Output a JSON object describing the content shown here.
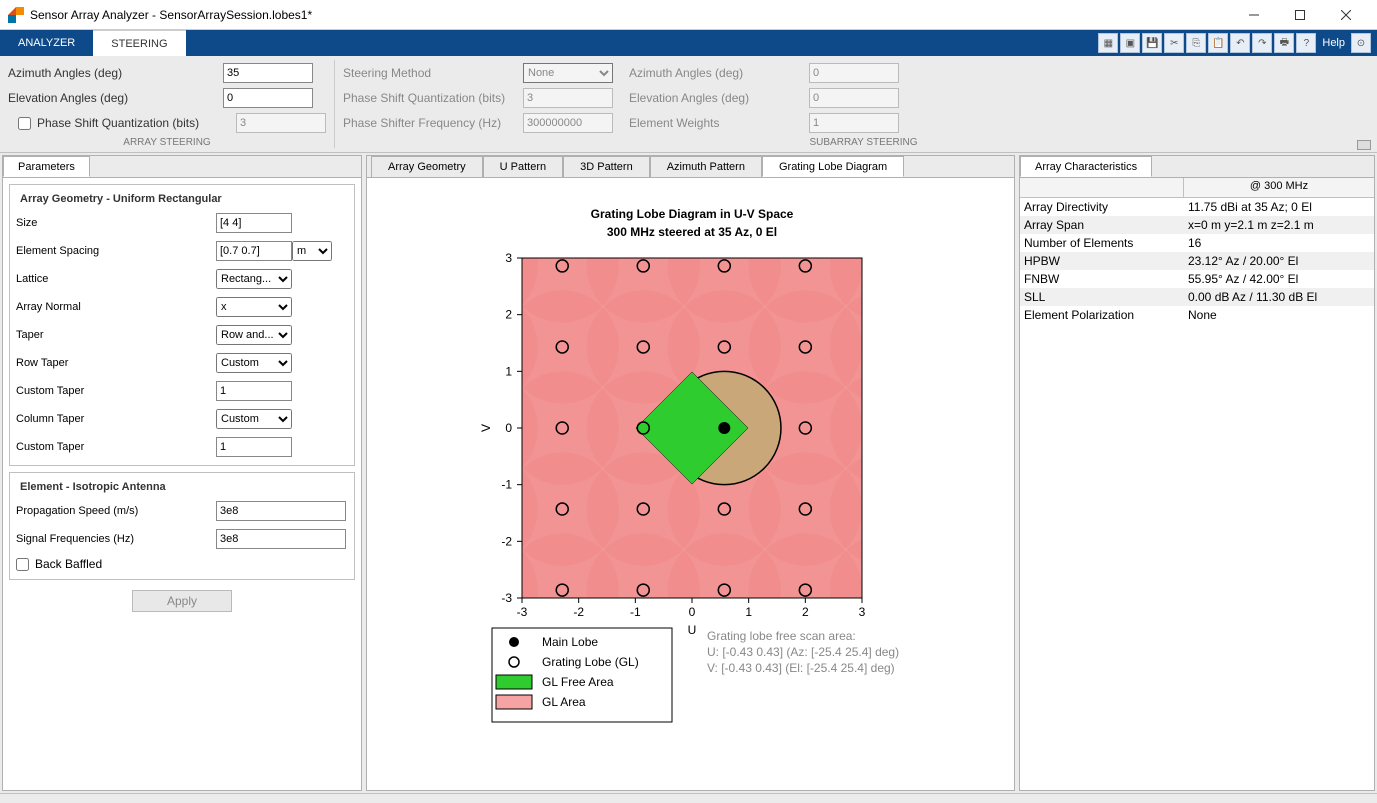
{
  "window": {
    "title": "Sensor Array Analyzer - SensorArraySession.lobes1*"
  },
  "ribbon": {
    "tabs": [
      "ANALYZER",
      "STEERING"
    ],
    "active": 1,
    "help": "Help"
  },
  "toolstrip": {
    "array_steering": {
      "azimuth_label": "Azimuth Angles (deg)",
      "azimuth_value": "35",
      "elevation_label": "Elevation Angles (deg)",
      "elevation_value": "0",
      "psq_label": "Phase Shift Quantization (bits)",
      "psq_value": "3",
      "group": "ARRAY STEERING"
    },
    "subarray_steering": {
      "method_label": "Steering Method",
      "method_value": "None",
      "psq_label": "Phase Shift Quantization (bits)",
      "psq_value": "3",
      "psf_label": "Phase Shifter Frequency (Hz)",
      "psf_value": "300000000",
      "az_label": "Azimuth Angles (deg)",
      "az_value": "0",
      "el_label": "Elevation Angles (deg)",
      "el_value": "0",
      "ew_label": "Element Weights",
      "ew_value": "1",
      "group": "SUBARRAY STEERING"
    }
  },
  "left": {
    "tab": "Parameters",
    "geometry": {
      "legend": "Array Geometry - Uniform Rectangular",
      "size_label": "Size",
      "size_value": "[4 4]",
      "spacing_label": "Element Spacing",
      "spacing_value": "[0.7 0.7]",
      "spacing_unit": "m",
      "lattice_label": "Lattice",
      "lattice_value": "Rectang...",
      "normal_label": "Array Normal",
      "normal_value": "x",
      "taper_label": "Taper",
      "taper_value": "Row and...",
      "rowtaper_label": "Row Taper",
      "rowtaper_value": "Custom",
      "custom1_label": "Custom Taper",
      "custom1_value": "1",
      "coltaper_label": "Column Taper",
      "coltaper_value": "Custom",
      "custom2_label": "Custom Taper",
      "custom2_value": "1"
    },
    "element": {
      "legend": "Element - Isotropic Antenna",
      "prop_label": "Propagation Speed (m/s)",
      "prop_value": "3e8",
      "freq_label": "Signal Frequencies (Hz)",
      "freq_value": "3e8",
      "back_label": "Back Baffled"
    },
    "apply": "Apply"
  },
  "center": {
    "tabs": [
      "Array Geometry",
      "U Pattern",
      "3D Pattern",
      "Azimuth Pattern",
      "Grating Lobe Diagram"
    ],
    "active": 4
  },
  "chart_data": {
    "type": "scatter",
    "title": "Grating Lobe Diagram in U-V Space",
    "subtitle": "300 MHz steered at 35 Az, 0 El",
    "xlabel": "U",
    "ylabel": "V",
    "xlim": [
      -3,
      3
    ],
    "ylim": [
      -3,
      3
    ],
    "ticks": [
      -3,
      -2,
      -1,
      0,
      1,
      2,
      3
    ],
    "main_lobe": {
      "u": 0.57,
      "v": 0
    },
    "grating_lobes_grid": {
      "du": 1.43,
      "dv": 1.43,
      "count_u": 5,
      "count_v": 5
    },
    "legend": {
      "main": "Main Lobe",
      "grating": "Grating Lobe (GL)",
      "free": "GL Free Area",
      "area": "GL Area"
    },
    "info": {
      "heading": "Grating lobe free scan area:",
      "u_line": "U: [-0.43 0.43] (Az: [-25.4 25.4] deg)",
      "v_line": "V: [-0.43 0.43] (El: [-25.4 25.4] deg)"
    }
  },
  "right": {
    "tab": "Array Characteristics",
    "freq_header": "@ 300 MHz",
    "rows": [
      {
        "k": "Array Directivity",
        "v": "11.75 dBi at 35 Az; 0 El"
      },
      {
        "k": "Array Span",
        "v": "x=0 m y=2.1 m z=2.1 m"
      },
      {
        "k": "Number of Elements",
        "v": "16"
      },
      {
        "k": "HPBW",
        "v": "23.12° Az / 20.00° El"
      },
      {
        "k": "FNBW",
        "v": "55.95° Az / 42.00° El"
      },
      {
        "k": "SLL",
        "v": "0.00 dB Az / 11.30 dB El"
      },
      {
        "k": "Element Polarization",
        "v": "None"
      }
    ]
  }
}
